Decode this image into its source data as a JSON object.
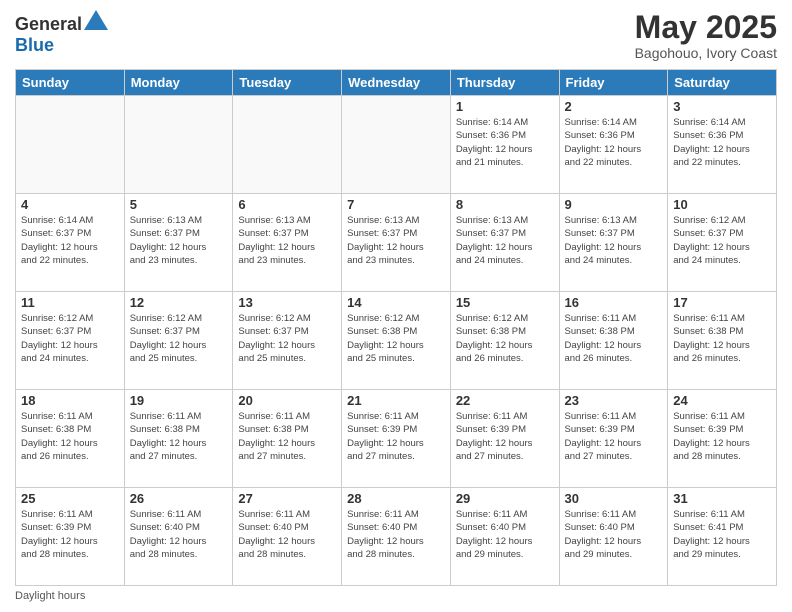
{
  "header": {
    "logo_general": "General",
    "logo_blue": "Blue",
    "title": "May 2025",
    "subtitle": "Bagohouo, Ivory Coast"
  },
  "weekdays": [
    "Sunday",
    "Monday",
    "Tuesday",
    "Wednesday",
    "Thursday",
    "Friday",
    "Saturday"
  ],
  "footnote": "Daylight hours",
  "weeks": [
    [
      {
        "day": "",
        "detail": ""
      },
      {
        "day": "",
        "detail": ""
      },
      {
        "day": "",
        "detail": ""
      },
      {
        "day": "",
        "detail": ""
      },
      {
        "day": "1",
        "detail": "Sunrise: 6:14 AM\nSunset: 6:36 PM\nDaylight: 12 hours\nand 21 minutes."
      },
      {
        "day": "2",
        "detail": "Sunrise: 6:14 AM\nSunset: 6:36 PM\nDaylight: 12 hours\nand 22 minutes."
      },
      {
        "day": "3",
        "detail": "Sunrise: 6:14 AM\nSunset: 6:36 PM\nDaylight: 12 hours\nand 22 minutes."
      }
    ],
    [
      {
        "day": "4",
        "detail": "Sunrise: 6:14 AM\nSunset: 6:37 PM\nDaylight: 12 hours\nand 22 minutes."
      },
      {
        "day": "5",
        "detail": "Sunrise: 6:13 AM\nSunset: 6:37 PM\nDaylight: 12 hours\nand 23 minutes."
      },
      {
        "day": "6",
        "detail": "Sunrise: 6:13 AM\nSunset: 6:37 PM\nDaylight: 12 hours\nand 23 minutes."
      },
      {
        "day": "7",
        "detail": "Sunrise: 6:13 AM\nSunset: 6:37 PM\nDaylight: 12 hours\nand 23 minutes."
      },
      {
        "day": "8",
        "detail": "Sunrise: 6:13 AM\nSunset: 6:37 PM\nDaylight: 12 hours\nand 24 minutes."
      },
      {
        "day": "9",
        "detail": "Sunrise: 6:13 AM\nSunset: 6:37 PM\nDaylight: 12 hours\nand 24 minutes."
      },
      {
        "day": "10",
        "detail": "Sunrise: 6:12 AM\nSunset: 6:37 PM\nDaylight: 12 hours\nand 24 minutes."
      }
    ],
    [
      {
        "day": "11",
        "detail": "Sunrise: 6:12 AM\nSunset: 6:37 PM\nDaylight: 12 hours\nand 24 minutes."
      },
      {
        "day": "12",
        "detail": "Sunrise: 6:12 AM\nSunset: 6:37 PM\nDaylight: 12 hours\nand 25 minutes."
      },
      {
        "day": "13",
        "detail": "Sunrise: 6:12 AM\nSunset: 6:37 PM\nDaylight: 12 hours\nand 25 minutes."
      },
      {
        "day": "14",
        "detail": "Sunrise: 6:12 AM\nSunset: 6:38 PM\nDaylight: 12 hours\nand 25 minutes."
      },
      {
        "day": "15",
        "detail": "Sunrise: 6:12 AM\nSunset: 6:38 PM\nDaylight: 12 hours\nand 26 minutes."
      },
      {
        "day": "16",
        "detail": "Sunrise: 6:11 AM\nSunset: 6:38 PM\nDaylight: 12 hours\nand 26 minutes."
      },
      {
        "day": "17",
        "detail": "Sunrise: 6:11 AM\nSunset: 6:38 PM\nDaylight: 12 hours\nand 26 minutes."
      }
    ],
    [
      {
        "day": "18",
        "detail": "Sunrise: 6:11 AM\nSunset: 6:38 PM\nDaylight: 12 hours\nand 26 minutes."
      },
      {
        "day": "19",
        "detail": "Sunrise: 6:11 AM\nSunset: 6:38 PM\nDaylight: 12 hours\nand 27 minutes."
      },
      {
        "day": "20",
        "detail": "Sunrise: 6:11 AM\nSunset: 6:38 PM\nDaylight: 12 hours\nand 27 minutes."
      },
      {
        "day": "21",
        "detail": "Sunrise: 6:11 AM\nSunset: 6:39 PM\nDaylight: 12 hours\nand 27 minutes."
      },
      {
        "day": "22",
        "detail": "Sunrise: 6:11 AM\nSunset: 6:39 PM\nDaylight: 12 hours\nand 27 minutes."
      },
      {
        "day": "23",
        "detail": "Sunrise: 6:11 AM\nSunset: 6:39 PM\nDaylight: 12 hours\nand 27 minutes."
      },
      {
        "day": "24",
        "detail": "Sunrise: 6:11 AM\nSunset: 6:39 PM\nDaylight: 12 hours\nand 28 minutes."
      }
    ],
    [
      {
        "day": "25",
        "detail": "Sunrise: 6:11 AM\nSunset: 6:39 PM\nDaylight: 12 hours\nand 28 minutes."
      },
      {
        "day": "26",
        "detail": "Sunrise: 6:11 AM\nSunset: 6:40 PM\nDaylight: 12 hours\nand 28 minutes."
      },
      {
        "day": "27",
        "detail": "Sunrise: 6:11 AM\nSunset: 6:40 PM\nDaylight: 12 hours\nand 28 minutes."
      },
      {
        "day": "28",
        "detail": "Sunrise: 6:11 AM\nSunset: 6:40 PM\nDaylight: 12 hours\nand 28 minutes."
      },
      {
        "day": "29",
        "detail": "Sunrise: 6:11 AM\nSunset: 6:40 PM\nDaylight: 12 hours\nand 29 minutes."
      },
      {
        "day": "30",
        "detail": "Sunrise: 6:11 AM\nSunset: 6:40 PM\nDaylight: 12 hours\nand 29 minutes."
      },
      {
        "day": "31",
        "detail": "Sunrise: 6:11 AM\nSunset: 6:41 PM\nDaylight: 12 hours\nand 29 minutes."
      }
    ]
  ]
}
